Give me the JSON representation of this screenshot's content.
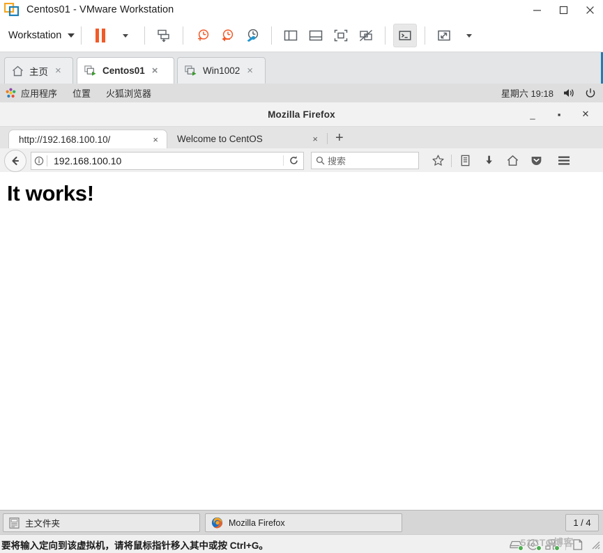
{
  "vmware": {
    "window_title": "Centos01 - VMware Workstation",
    "logo_icon": "vmware-logo-icon",
    "window_controls": {
      "minimize": "minimize-icon",
      "maximize": "maximize-icon",
      "close": "close-icon"
    },
    "toolbar": {
      "menu_label": "Workstation",
      "buttons": [
        {
          "name": "pause-vm-button",
          "icon": "pause-icon"
        },
        {
          "name": "pause-dropdown-button",
          "icon": "chevron-down-icon"
        },
        {
          "name": "send-ctrl-alt-del-button",
          "icon": "keyboard-send-icon"
        },
        {
          "name": "take-snapshot-button",
          "icon": "snapshot-add-icon"
        },
        {
          "name": "revert-snapshot-button",
          "icon": "snapshot-revert-icon"
        },
        {
          "name": "snapshot-manager-button",
          "icon": "snapshot-manager-icon"
        },
        {
          "name": "show-sidebar-button",
          "icon": "sidebar-panel-icon"
        },
        {
          "name": "show-console-view-button",
          "icon": "bottom-panel-icon"
        },
        {
          "name": "full-screen-button",
          "icon": "fullscreen-icon"
        },
        {
          "name": "unity-mode-button",
          "icon": "unity-off-icon"
        },
        {
          "name": "console-terminal-button",
          "icon": "terminal-icon"
        },
        {
          "name": "stretch-guest-button",
          "icon": "expand-arrows-icon"
        },
        {
          "name": "stretch-dropdown-button",
          "icon": "chevron-down-icon"
        }
      ]
    },
    "vm_tabs": [
      {
        "label": "主页",
        "icon": "home-icon",
        "selected": false,
        "close": "×"
      },
      {
        "label": "Centos01",
        "icon": "vm-powered-on-icon",
        "selected": true,
        "close": "×"
      },
      {
        "label": "Win1002",
        "icon": "vm-powered-on-icon",
        "selected": false,
        "close": "×"
      }
    ],
    "status": {
      "message": "要将输入定向到该虚拟机，请将鼠标指针移入其中或按 Ctrl+G。",
      "watermark": "51CTO博客",
      "devices": [
        {
          "name": "hard-disk-device-icon",
          "icon": "hard-disk-icon"
        },
        {
          "name": "cd-dvd-device-icon",
          "icon": "cd-icon"
        },
        {
          "name": "network-device-icon",
          "icon": "network-icon"
        },
        {
          "name": "printer-device-icon",
          "icon": "printer-icon"
        }
      ],
      "resize_grip": "resize-grip-icon"
    }
  },
  "guest": {
    "top_panel": {
      "activities_icon": "gnome-applications-icon",
      "items": [
        "应用程序",
        "位置",
        "火狐浏览器"
      ],
      "clock": "星期六 19:18",
      "volume_icon": "volume-icon",
      "power_icon": "power-icon"
    },
    "firefox": {
      "window_title": "Mozilla Firefox",
      "window_controls": {
        "minimize": "_",
        "maximize": "▪",
        "close": "✕"
      },
      "tabs": [
        {
          "title": "http://192.168.100.10/",
          "selected": true,
          "close": "×"
        },
        {
          "title": "Welcome to CentOS",
          "selected": false,
          "close": "×"
        }
      ],
      "new_tab_label": "+",
      "nav": {
        "back_icon": "back-arrow-icon",
        "identity_icon": "page-info-icon",
        "url_value": "192.168.100.10",
        "reload_icon": "reload-icon",
        "search_icon": "search-icon",
        "search_placeholder": "搜索",
        "icons": [
          {
            "name": "bookmark-star-icon"
          },
          {
            "name": "library-icon"
          },
          {
            "name": "downloads-icon"
          },
          {
            "name": "home-icon"
          },
          {
            "name": "pocket-icon"
          },
          {
            "name": "hamburger-menu-icon"
          }
        ]
      },
      "page": {
        "heading": "It works!"
      }
    },
    "bottom_panel": {
      "tasks": [
        {
          "label": "主文件夹",
          "icon": "file-manager-icon"
        },
        {
          "label": "Mozilla Firefox",
          "icon": "firefox-icon"
        }
      ],
      "workspace_indicator": "1 / 4"
    }
  },
  "colors": {
    "vmware_orange": "#f15a29",
    "tab_accent": "#1a7fb5",
    "vm_running_green": "#3b9a2e",
    "panel_gray": "#dedede"
  }
}
